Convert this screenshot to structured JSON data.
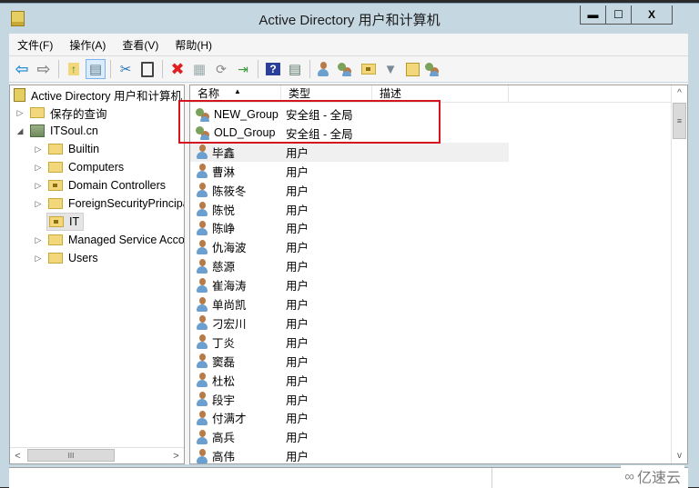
{
  "window": {
    "title": "Active Directory 用户和计算机",
    "controls": {
      "minimize": "▬",
      "maximize": "☐",
      "close": "X"
    }
  },
  "menu": {
    "items": [
      "文件(F)",
      "操作(A)",
      "查看(V)",
      "帮助(H)"
    ]
  },
  "toolbar": {
    "icons": {
      "back": "⇦",
      "forward": "⇨",
      "up": "↑",
      "console_tree": "▤",
      "cut": "✂",
      "paste": "📋",
      "delete": "✖",
      "properties": "▦",
      "refresh": "⟳",
      "export": "⇥",
      "help": "?",
      "action_pane": "▤",
      "new_user": "👤",
      "new_group": "👥",
      "new_ou": "📁",
      "filter": "▼",
      "find": "🔍",
      "add_to_group": "⟲"
    }
  },
  "tree": {
    "root": "Active Directory 用户和计算机",
    "nodes": [
      {
        "label": "保存的查询",
        "expander": "▷",
        "icon": "folder"
      },
      {
        "label": "ITSoul.cn",
        "expander": "◢",
        "icon": "domain"
      },
      {
        "label": "Builtin",
        "expander": "▷",
        "icon": "folder"
      },
      {
        "label": "Computers",
        "expander": "▷",
        "icon": "folder"
      },
      {
        "label": "Domain Controllers",
        "expander": "▷",
        "icon": "ou"
      },
      {
        "label": "ForeignSecurityPrincipals",
        "expander": "▷",
        "icon": "folder"
      },
      {
        "label": "IT",
        "expander": "",
        "icon": "ou",
        "selected": true
      },
      {
        "label": "Managed Service Accounts",
        "expander": "▷",
        "icon": "folder"
      },
      {
        "label": "Users",
        "expander": "▷",
        "icon": "folder"
      }
    ],
    "scroll": {
      "left": "<",
      "right": ">",
      "thumb": "III"
    }
  },
  "list": {
    "columns": [
      "名称",
      "类型",
      "描述"
    ],
    "sort_indicator": "▲",
    "rows": [
      {
        "name": "NEW_Group",
        "type": "安全组 - 全局",
        "icon": "group"
      },
      {
        "name": "OLD_Group",
        "type": "安全组 - 全局",
        "icon": "group"
      },
      {
        "name": "毕鑫",
        "type": "用户",
        "icon": "user"
      },
      {
        "name": "曹淋",
        "type": "用户",
        "icon": "user"
      },
      {
        "name": "陈筱冬",
        "type": "用户",
        "icon": "user"
      },
      {
        "name": "陈悦",
        "type": "用户",
        "icon": "user"
      },
      {
        "name": "陈峥",
        "type": "用户",
        "icon": "user"
      },
      {
        "name": "仇海波",
        "type": "用户",
        "icon": "user"
      },
      {
        "name": "慈源",
        "type": "用户",
        "icon": "user"
      },
      {
        "name": "崔海涛",
        "type": "用户",
        "icon": "user"
      },
      {
        "name": "单尚凯",
        "type": "用户",
        "icon": "user"
      },
      {
        "name": "刁宏川",
        "type": "用户",
        "icon": "user"
      },
      {
        "name": "丁炎",
        "type": "用户",
        "icon": "user"
      },
      {
        "name": "窦磊",
        "type": "用户",
        "icon": "user"
      },
      {
        "name": "杜松",
        "type": "用户",
        "icon": "user"
      },
      {
        "name": "段宇",
        "type": "用户",
        "icon": "user"
      },
      {
        "name": "付满才",
        "type": "用户",
        "icon": "user"
      },
      {
        "name": "高兵",
        "type": "用户",
        "icon": "user"
      },
      {
        "name": "高伟",
        "type": "用户",
        "icon": "user"
      }
    ],
    "scroll": {
      "up": "^",
      "down": "v",
      "thumb": "≡"
    }
  },
  "watermark": {
    "text": "亿速云",
    "icon": "∞"
  },
  "colors": {
    "highlight_box": "#d4141e"
  }
}
